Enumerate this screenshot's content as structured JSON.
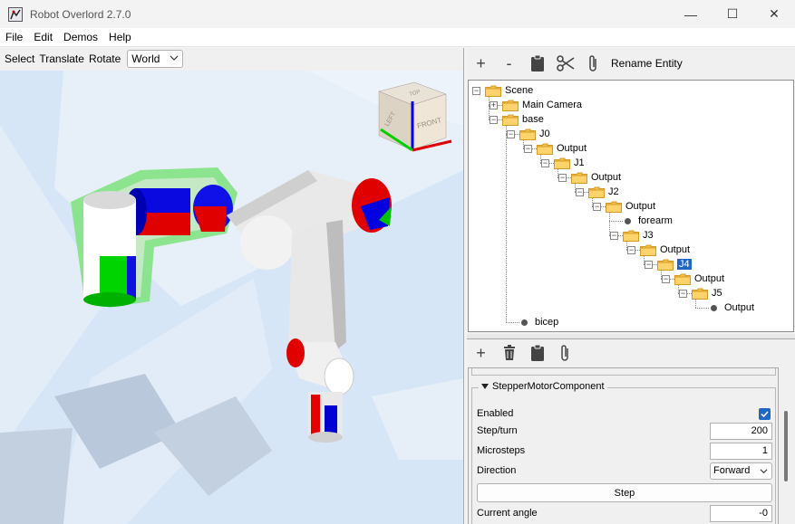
{
  "window": {
    "title": "Robot Overlord 2.7.0",
    "controls": {
      "minimize": "—",
      "maximize": "☐",
      "close": "✕"
    }
  },
  "menu": [
    "File",
    "Edit",
    "Demos",
    "Help"
  ],
  "viewport_toolbar": {
    "select": "Select",
    "translate": "Translate",
    "rotate": "Rotate",
    "frame_value": "World"
  },
  "view_cube": {
    "top": "TOP",
    "left": "LEFT",
    "front": "FRONT"
  },
  "entity_toolbar": {
    "add_icon": "+",
    "remove_icon": "-",
    "paste_icon": "clipboard-icon",
    "cut_icon": "scissors-icon",
    "attach_icon": "paperclip-icon",
    "rename_label": "Rename Entity"
  },
  "tree": {
    "nodes": [
      {
        "label": "Scene",
        "kind": "folder",
        "toggle": "-"
      },
      {
        "label": "Main Camera",
        "kind": "folder",
        "toggle": "+"
      },
      {
        "label": "base",
        "kind": "folder",
        "toggle": "-"
      },
      {
        "label": "J0",
        "kind": "folder",
        "toggle": "-"
      },
      {
        "label": "Output",
        "kind": "folder",
        "toggle": "-"
      },
      {
        "label": "J1",
        "kind": "folder",
        "toggle": "-"
      },
      {
        "label": "Output",
        "kind": "folder",
        "toggle": "-"
      },
      {
        "label": "J2",
        "kind": "folder",
        "toggle": "-"
      },
      {
        "label": "Output",
        "kind": "folder",
        "toggle": "-"
      },
      {
        "label": "forearm",
        "kind": "leaf"
      },
      {
        "label": "J3",
        "kind": "folder",
        "toggle": "-"
      },
      {
        "label": "Output",
        "kind": "folder",
        "toggle": "-"
      },
      {
        "label": "J4",
        "kind": "folder",
        "toggle": "-",
        "selected": true
      },
      {
        "label": "Output",
        "kind": "folder",
        "toggle": "-"
      },
      {
        "label": "J5",
        "kind": "folder",
        "toggle": "-"
      },
      {
        "label": "Output",
        "kind": "leaf"
      },
      {
        "label": "bicep",
        "kind": "leaf"
      }
    ]
  },
  "component_toolbar": {
    "add_icon": "+",
    "delete_icon": "trash-icon",
    "paste_icon": "clipboard-icon",
    "attach_icon": "paperclip-icon"
  },
  "component": {
    "title": "StepperMotorComponent",
    "enabled_label": "Enabled",
    "enabled": true,
    "step_turn_label": "Step/turn",
    "step_turn_value": "200",
    "microsteps_label": "Microsteps",
    "microsteps_value": "1",
    "direction_label": "Direction",
    "direction_value": "Forward",
    "step_button": "Step",
    "current_angle_label": "Current angle",
    "current_angle_value": "-0"
  },
  "colors": {
    "selection": "#1f67c4",
    "viewport_bg": "#d6e6f7",
    "joint_red": "#e00000",
    "joint_blue": "#0000e0",
    "joint_green": "#00d000",
    "highlight_green": "#7de27d"
  }
}
